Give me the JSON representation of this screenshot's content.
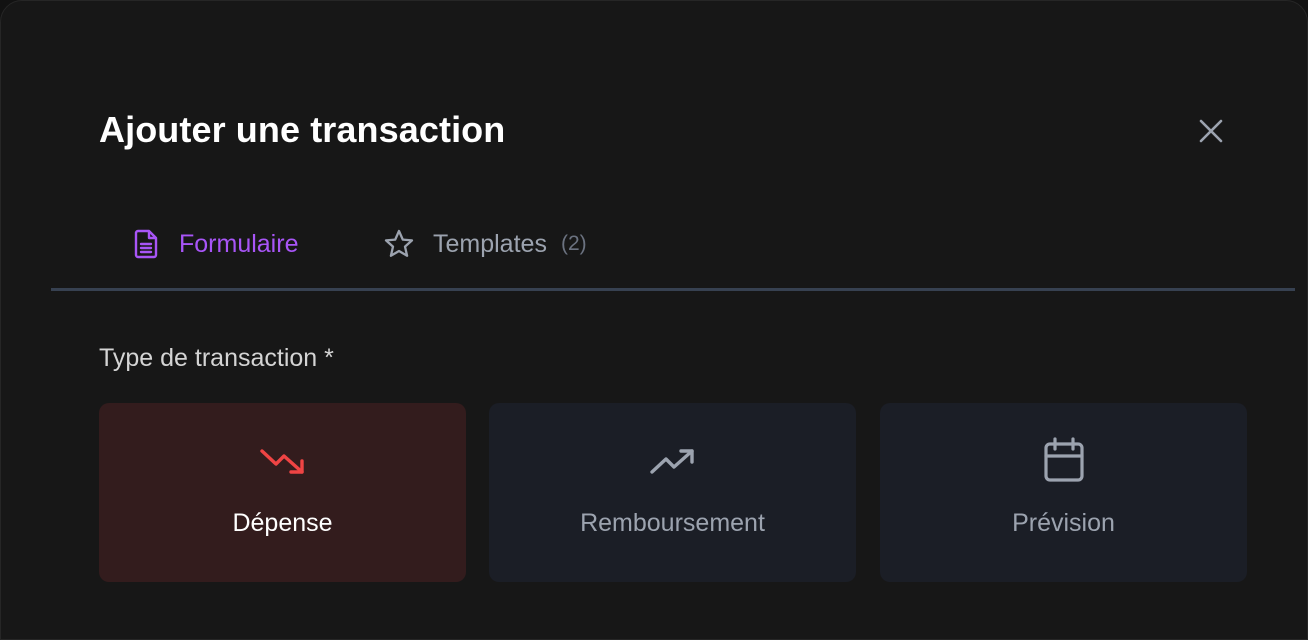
{
  "modal": {
    "title": "Ajouter une transaction",
    "close_icon": "close-icon"
  },
  "tabs": [
    {
      "label": "Formulaire",
      "icon": "document-icon",
      "active": true
    },
    {
      "label": "Templates",
      "icon": "star-icon",
      "count": "(2)",
      "active": false
    }
  ],
  "transaction_type": {
    "label": "Type de transaction *",
    "options": [
      {
        "label": "Dépense",
        "icon": "trending-down-icon",
        "selected": true
      },
      {
        "label": "Remboursement",
        "icon": "trending-up-icon",
        "selected": false
      },
      {
        "label": "Prévision",
        "icon": "calendar-icon",
        "selected": false
      }
    ]
  },
  "colors": {
    "accent": "#a855f7",
    "expense_red": "#ef4444",
    "muted": "#9ca3af",
    "background": "#171717"
  }
}
